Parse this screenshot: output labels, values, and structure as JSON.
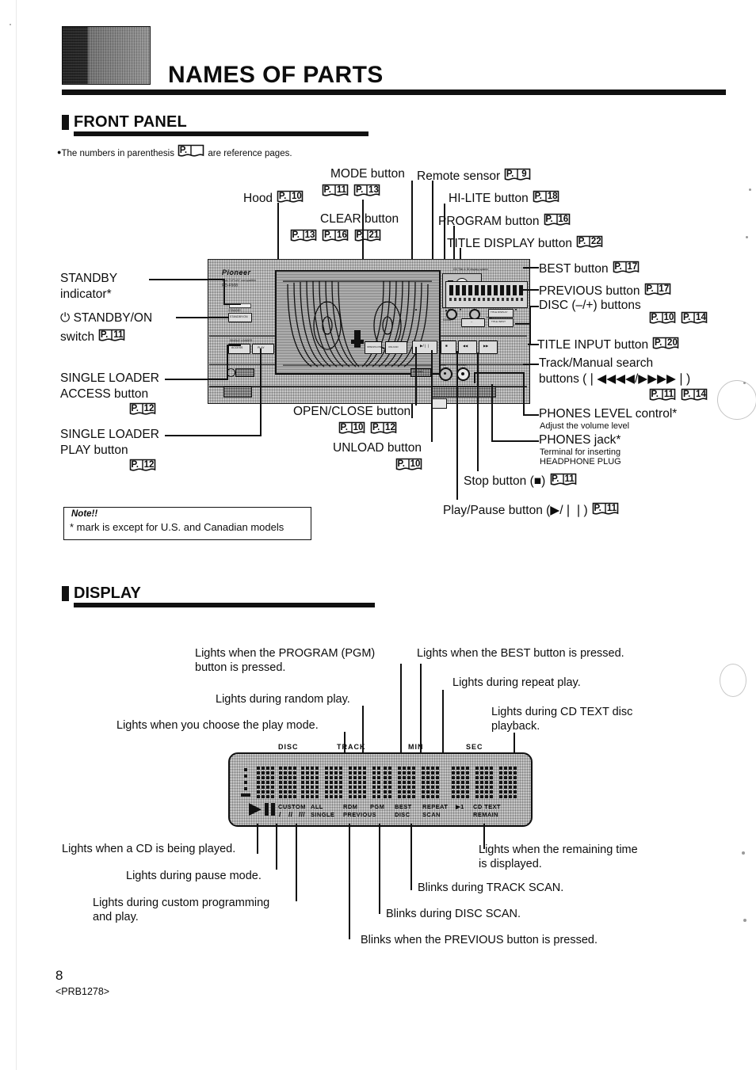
{
  "page": {
    "title": "NAMES OF PARTS",
    "number": "8",
    "code": "<PRB1278>"
  },
  "legend": {
    "prefix": "The numbers in parenthesis",
    "suffix": "are reference pages.",
    "icon_label": "P."
  },
  "sections": {
    "front_panel": "FRONT PANEL",
    "display": "DISPLAY"
  },
  "note": {
    "title": "Note!!",
    "body": "* mark is except for U.S. and Canadian models"
  },
  "front_panel_callouts": {
    "hood": {
      "label": "Hood",
      "refs": [
        "10"
      ]
    },
    "mode_button": {
      "label": "MODE button",
      "refs": [
        "11",
        "13"
      ]
    },
    "remote_sensor": {
      "label": "Remote sensor",
      "refs": [
        "9"
      ]
    },
    "hi_lite_button": {
      "label": "HI-LITE button",
      "refs": [
        "18"
      ]
    },
    "clear_button": {
      "label": "CLEAR button",
      "refs": [
        "13",
        "16",
        "21"
      ]
    },
    "program_button": {
      "label": "PROGRAM button",
      "refs": [
        "16"
      ]
    },
    "title_display_button": {
      "label": "TITLE DISPLAY button",
      "refs": [
        "22"
      ]
    },
    "best_button": {
      "label": "BEST button",
      "refs": [
        "17"
      ]
    },
    "previous_button": {
      "label": "PREVIOUS button",
      "refs": [
        "17"
      ]
    },
    "disc_buttons": {
      "label": "DISC (–/+) buttons",
      "refs": [
        "10",
        "14"
      ]
    },
    "title_input_button": {
      "label": "TITLE INPUT button",
      "refs": [
        "20"
      ]
    },
    "track_manual_search": {
      "label_line1": "Track/Manual search",
      "label_line2": "buttons (❘◀◀◀◀/▶▶▶▶❘)",
      "refs": [
        "11",
        "14"
      ]
    },
    "phones_level": {
      "label": "PHONES LEVEL control*",
      "sub": "Adjust the volume level"
    },
    "phones_jack": {
      "label": "PHONES jack*",
      "sub_line1": "Terminal for inserting",
      "sub_line2": "HEADPHONE PLUG"
    },
    "standby_indicator": {
      "label_line1": "STANDBY",
      "label_line2": "indicator*"
    },
    "standby_on_switch": {
      "label_line1": "⏻ STANDBY/ON",
      "label_line2": "switch",
      "refs": [
        "11"
      ]
    },
    "single_loader_access": {
      "label_line1": "SINGLE LOADER",
      "label_line2": "ACCESS button",
      "refs": [
        "12"
      ]
    },
    "single_loader_play": {
      "label_line1": "SINGLE LOADER",
      "label_line2": "PLAY button",
      "refs": [
        "12"
      ]
    },
    "open_close_button": {
      "label": "OPEN/CLOSE button",
      "refs": [
        "10",
        "12"
      ]
    },
    "unload_button": {
      "label": "UNLOAD button",
      "refs": [
        "10"
      ]
    },
    "stop_button": {
      "label": "Stop button (■)",
      "refs": [
        "11"
      ]
    },
    "play_pause_button": {
      "label": "Play/Pause button (▶/❘❘)",
      "refs": [
        "11"
      ]
    }
  },
  "unit": {
    "brand": "Pioneer",
    "model_line1": "MULTI-PLAY compatible",
    "model_line2": "PD-F908",
    "cd_text_badge": "CD Title & ID display system",
    "legato": "LEGATO LINK CONVERSION",
    "buttons": {
      "standby": "STANDBY/ON",
      "access": "ACCESS",
      "play": "PLAY",
      "single_loader": "SINGLE LOADER",
      "clear": "CLEAR",
      "program": "PROGRAM",
      "mode": "MODE",
      "hi_lite": "HI-LITE",
      "title_display": "TITLE DISPLAY",
      "best": "BEST",
      "previous": "PREVIOUS",
      "title_input": "TITLE INPUT",
      "disc_minus": "–",
      "disc_plus": "+",
      "open_close": "OPEN/CLOSE",
      "unload": "UNLOAD",
      "play_pause": "▶/❘❘",
      "stop": "■",
      "search_rev": "◀◀",
      "search_fwd": "▶▶",
      "phones": "PHONES",
      "level": "LEVEL"
    }
  },
  "display_callouts": {
    "play_mode": "Lights when you choose the play mode.",
    "random": "Lights during random play.",
    "program_line1": "Lights when the PROGRAM (PGM)",
    "program_line2": "button is pressed.",
    "best": "Lights when the BEST button is pressed.",
    "repeat": "Lights during repeat play.",
    "cd_text_line1": "Lights during CD TEXT disc",
    "cd_text_line2": "playback.",
    "playing": "Lights when a CD is being played.",
    "pause": "Lights during pause mode.",
    "custom_line1": "Lights during custom programming",
    "custom_line2": "and play.",
    "previous_blink": "Blinks when the PREVIOUS button is pressed.",
    "disc_scan": "Blinks during DISC SCAN.",
    "track_scan": "Blinks during TRACK SCAN.",
    "remain_line1": "Lights when the remaining time",
    "remain_line2": "is displayed."
  },
  "display_panel": {
    "top_labels": [
      "DISC",
      "TRACK",
      "MIN",
      "SEC"
    ],
    "indicators_row1": [
      "CUSTOM",
      "ALL",
      "RDM",
      "PGM",
      "BEST",
      "REPEAT",
      "▶1",
      "CD TEXT"
    ],
    "indicators_row2": [
      "I",
      "II",
      "III",
      "SINGLE",
      "PREVIOUS",
      "DISC",
      "SCAN",
      "REMAIN"
    ],
    "transport_play": "▶",
    "transport_pause": "❘❘"
  },
  "colors": {
    "ink": "#0d0d0d",
    "paper": "#ffffff",
    "panel": "#c9c9c9"
  }
}
